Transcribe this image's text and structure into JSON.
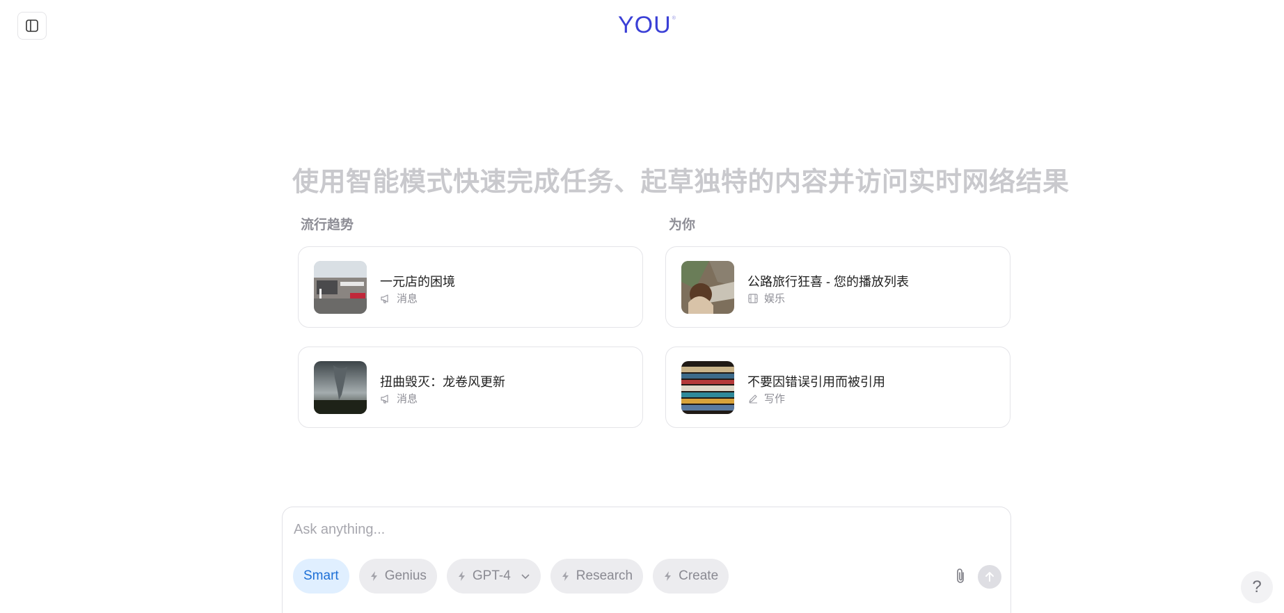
{
  "app": {
    "logo_text": "YOU",
    "logo_mark": "®"
  },
  "colors": {
    "brand": "#3a3fd6",
    "headline": "#c9c9cd",
    "active_mode_bg": "#e0efff",
    "active_mode_text": "#1d6fd6"
  },
  "headline": "使用智能模式快速完成任务、起草独特的内容并访问实时网络结果",
  "trending": {
    "label": "流行趋势",
    "cards": [
      {
        "title": "一元店的困境",
        "category": "消息",
        "icon": "megaphone-icon",
        "thumb": "storefront-photo"
      },
      {
        "title": "扭曲毁灭：龙卷风更新",
        "category": "消息",
        "icon": "megaphone-icon",
        "thumb": "tornado-photo"
      }
    ]
  },
  "for_you": {
    "label": "为你",
    "cards": [
      {
        "title": "公路旅行狂喜 - 您的播放列表",
        "category": "娱乐",
        "icon": "film-icon",
        "thumb": "road-trip-photo"
      },
      {
        "title": "不要因错误引用而被引用",
        "category": "写作",
        "icon": "pencil-icon",
        "thumb": "books-photo"
      }
    ]
  },
  "composer": {
    "placeholder": "Ask anything...",
    "modes": [
      {
        "label": "Smart",
        "active": true
      },
      {
        "label": "Genius",
        "active": false
      },
      {
        "label": "GPT-4",
        "active": false,
        "has_dropdown": true
      },
      {
        "label": "Research",
        "active": false
      },
      {
        "label": "Create",
        "active": false
      }
    ]
  },
  "help_label": "?"
}
